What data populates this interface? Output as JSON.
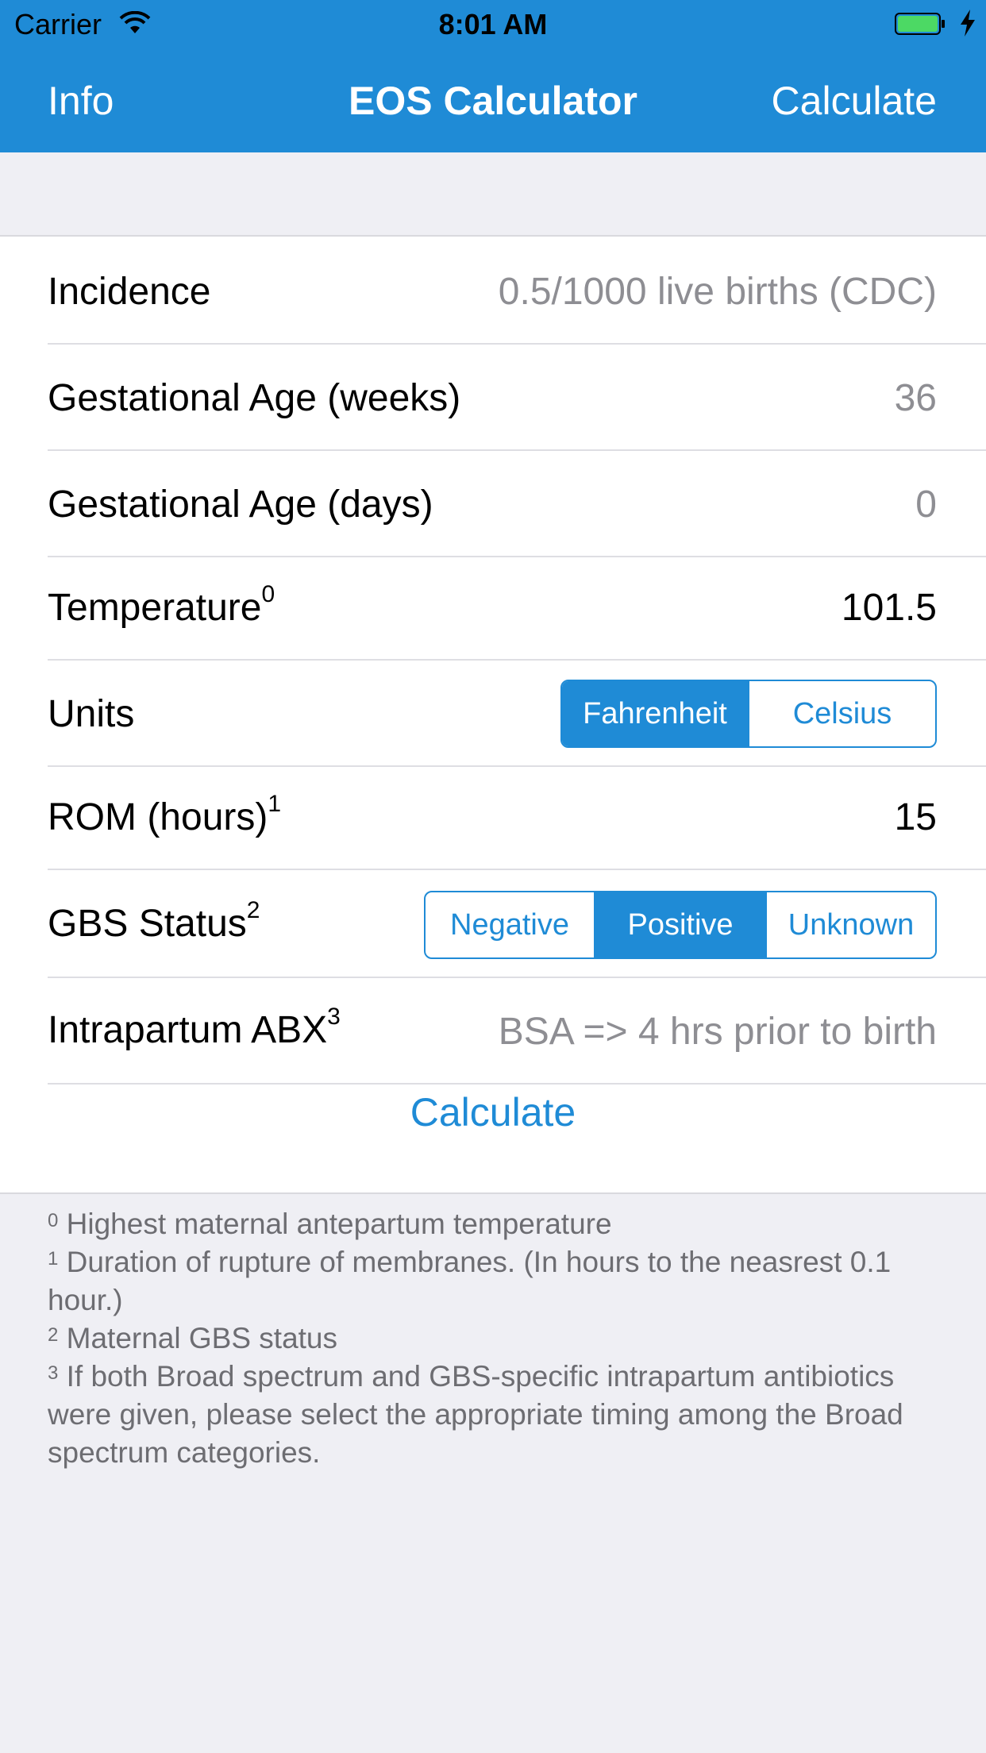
{
  "status_bar": {
    "carrier": "Carrier",
    "time": "8:01 AM"
  },
  "nav": {
    "left": "Info",
    "title": "EOS Calculator",
    "right": "Calculate"
  },
  "rows": {
    "incidence": {
      "label": "Incidence",
      "value": "0.5/1000 live births (CDC)"
    },
    "ga_weeks": {
      "label": "Gestational Age (weeks)",
      "value": "36"
    },
    "ga_days": {
      "label": "Gestational Age (days)",
      "value": "0"
    },
    "temperature": {
      "label": "Temperature",
      "sup": "0",
      "value": "101.5"
    },
    "units": {
      "label": "Units",
      "options": [
        "Fahrenheit",
        "Celsius"
      ],
      "selected": "Fahrenheit"
    },
    "rom": {
      "label": "ROM (hours)",
      "sup": "1",
      "value": "15"
    },
    "gbs": {
      "label": "GBS Status",
      "sup": "2",
      "options": [
        "Negative",
        "Positive",
        "Unknown"
      ],
      "selected": "Positive"
    },
    "abx": {
      "label": "Intrapartum ABX",
      "sup": "3",
      "value": "BSA => 4 hrs prior to birth"
    }
  },
  "calculate_button": "Calculate",
  "footnotes": [
    {
      "mark": "0",
      "text": " Highest maternal antepartum temperature"
    },
    {
      "mark": "1",
      "text": " Duration of rupture of membranes. (In hours to the neasrest 0.1 hour.)"
    },
    {
      "mark": "2",
      "text": " Maternal GBS status"
    },
    {
      "mark": "3",
      "text": " If both Broad spectrum and GBS-specific intrapartum antibiotics were given, please select the appropriate timing among the Broad spectrum categories."
    }
  ],
  "colors": {
    "accent": "#1f8bd6",
    "background": "#efeff4",
    "battery": "#4cd964"
  }
}
